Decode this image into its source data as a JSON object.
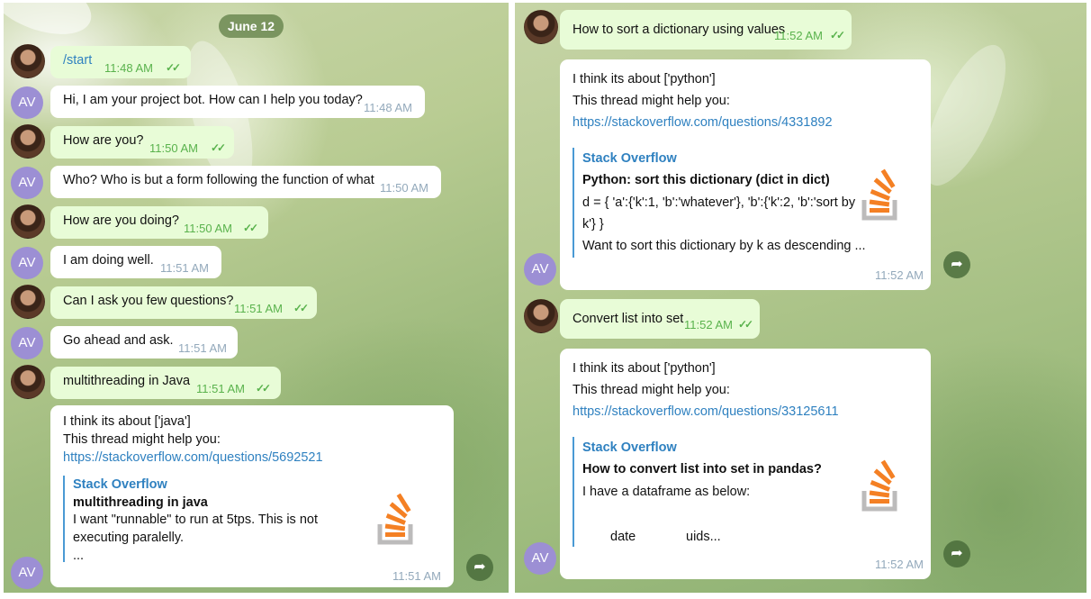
{
  "left": {
    "date": "June 12",
    "messages": [
      {
        "dir": "out",
        "text": "/start",
        "time": "11:48 AM"
      },
      {
        "dir": "in",
        "text": "Hi, I am your project bot. How can I help you today?",
        "time": "11:48 AM"
      },
      {
        "dir": "out",
        "text": "How are you?",
        "time": "11:50 AM"
      },
      {
        "dir": "in",
        "text": "Who? Who is but a form following the function of what",
        "time": "11:50 AM"
      },
      {
        "dir": "out",
        "text": "How are you doing?",
        "time": "11:50 AM"
      },
      {
        "dir": "in",
        "text": "I am doing well.",
        "time": "11:51 AM"
      },
      {
        "dir": "out",
        "text": "Can I ask you few questions?",
        "time": "11:51 AM"
      },
      {
        "dir": "in",
        "text": "Go ahead and ask.",
        "time": "11:51 AM"
      },
      {
        "dir": "out",
        "text": "multithreading in Java",
        "time": "11:51 AM"
      }
    ],
    "reply": {
      "line1": "I think its about ['java']",
      "line2": "This thread might help you:",
      "link": "https://stackoverflow.com/questions/5692521",
      "site": "Stack Overflow",
      "title": "multithreading in java",
      "desc1": "I want \"runnable\" to run at 5tps. This is not",
      "desc2": "executing paralelly.",
      "desc3": "...",
      "time": "11:51 AM"
    }
  },
  "right": {
    "q1": {
      "text": "How to sort a dictionary using values",
      "time": "11:52 AM"
    },
    "r1": {
      "line1": "I think its about ['python']",
      "line2": "This thread might help you:",
      "link": "https://stackoverflow.com/questions/4331892",
      "site": "Stack Overflow",
      "title": "Python: sort this dictionary (dict in dict)",
      "desc1": "d = { 'a':{'k':1, 'b':'whatever'},  'b':{'k':2, 'b':'sort by",
      "desc2": "k'} }",
      "desc3": "Want to sort this dictionary by k as descending ...",
      "time": "11:52 AM"
    },
    "q2": {
      "text": "Convert list into set",
      "time": "11:52 AM"
    },
    "r2": {
      "line1": "I think its about ['python']",
      "line2": "This thread might help you:",
      "link": "https://stackoverflow.com/questions/33125611",
      "site": "Stack Overflow",
      "title": "How to convert list into set in pandas?",
      "desc1": "I have a dataframe as below:",
      "col1": "date",
      "col2": "uids...",
      "time": "11:52 AM"
    }
  },
  "avatar_initials": "AV",
  "colors": {
    "outgoing": "#e8fcd7",
    "incoming": "#ffffff",
    "link": "#2f81c0",
    "check": "#59b24c",
    "avatar": "#9c8fd4"
  },
  "icons": {
    "ticks": "double-check-icon",
    "share": "share-arrow-icon",
    "logo": "stackoverflow-logo-icon"
  }
}
